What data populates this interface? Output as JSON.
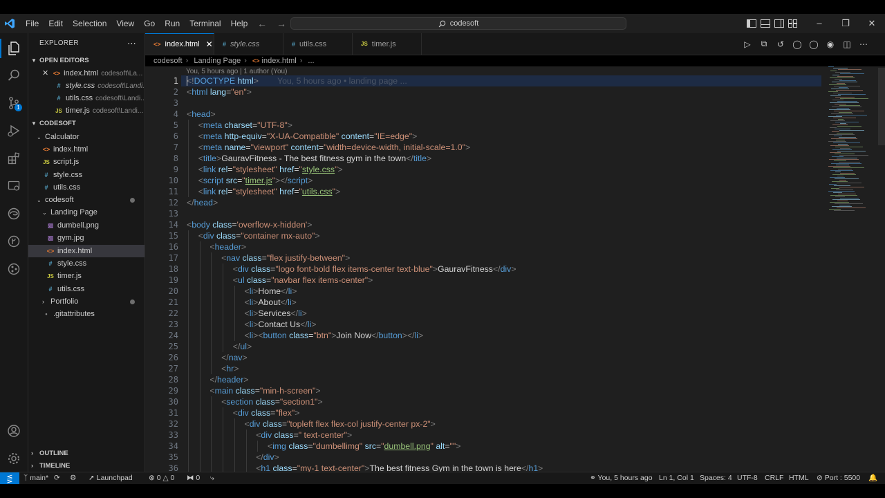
{
  "menu": [
    "File",
    "Edit",
    "Selection",
    "View",
    "Go",
    "Run",
    "Terminal",
    "Help"
  ],
  "command_center": "codesoft",
  "colors": {
    "accent": "#0078d4",
    "tag": "#569cd6",
    "attr": "#9cdcfe",
    "string": "#ce9178",
    "text": "#d4d4d4",
    "bracket": "#808080",
    "link": "#98c379"
  },
  "explorer": {
    "title": "EXPLORER",
    "open_editors_label": "OPEN EDITORS",
    "open_editors": [
      {
        "name": "index.html",
        "path": "codesoft\\La..."
      },
      {
        "name": "style.css",
        "path": "codesoft\\Landi..."
      },
      {
        "name": "utils.css",
        "path": "codesoft\\Landi..."
      },
      {
        "name": "timer.js",
        "path": "codesoft\\Landi..."
      }
    ],
    "workspace_label": "CODESOFT",
    "tree": [
      {
        "name": "Calculator"
      },
      {
        "name": "index.html"
      },
      {
        "name": "script.js"
      },
      {
        "name": "style.css"
      },
      {
        "name": "utils.css"
      },
      {
        "name": "codesoft"
      },
      {
        "name": "Landing Page"
      },
      {
        "name": "dumbell.png"
      },
      {
        "name": "gym.jpg"
      },
      {
        "name": "index.html"
      },
      {
        "name": "style.css"
      },
      {
        "name": "timer.js"
      },
      {
        "name": "utils.css"
      },
      {
        "name": "Portfolio"
      },
      {
        "name": ".gitattributes"
      }
    ],
    "outline_label": "OUTLINE",
    "timeline_label": "TIMELINE"
  },
  "tabs": [
    {
      "label": "index.html",
      "icon": "<>"
    },
    {
      "label": "style.css",
      "icon": "#"
    },
    {
      "label": "utils.css",
      "icon": "#"
    },
    {
      "label": "timer.js",
      "icon": "JS"
    }
  ],
  "breadcrumb": [
    "codesoft",
    "Landing Page",
    "index.html",
    "..."
  ],
  "blame": "You, 5 hours ago | 1 author (You)",
  "inline_blame": "You, 5 hours ago • landing page ...",
  "line_numbers": [
    "1",
    "2",
    "3",
    "4",
    "5",
    "6",
    "7",
    "8",
    "9",
    "10",
    "11",
    "12",
    "13",
    "14",
    "15",
    "16",
    "17",
    "18",
    "19",
    "20",
    "21",
    "22",
    "23",
    "24",
    "25",
    "26",
    "27",
    "28",
    "29",
    "30",
    "31",
    "32",
    "33",
    "34",
    "35",
    "36"
  ],
  "status": {
    "branch": "main*",
    "launchpad": "Launchpad",
    "errors": "0",
    "warnings": "0",
    "ports_count": "0",
    "blame": "You, 5 hours ago",
    "position": "Ln 1, Col 1",
    "spaces": "Spaces: 4",
    "encoding": "UTF-8",
    "eol": "CRLF",
    "language": "HTML",
    "port": "Port : 5500"
  }
}
